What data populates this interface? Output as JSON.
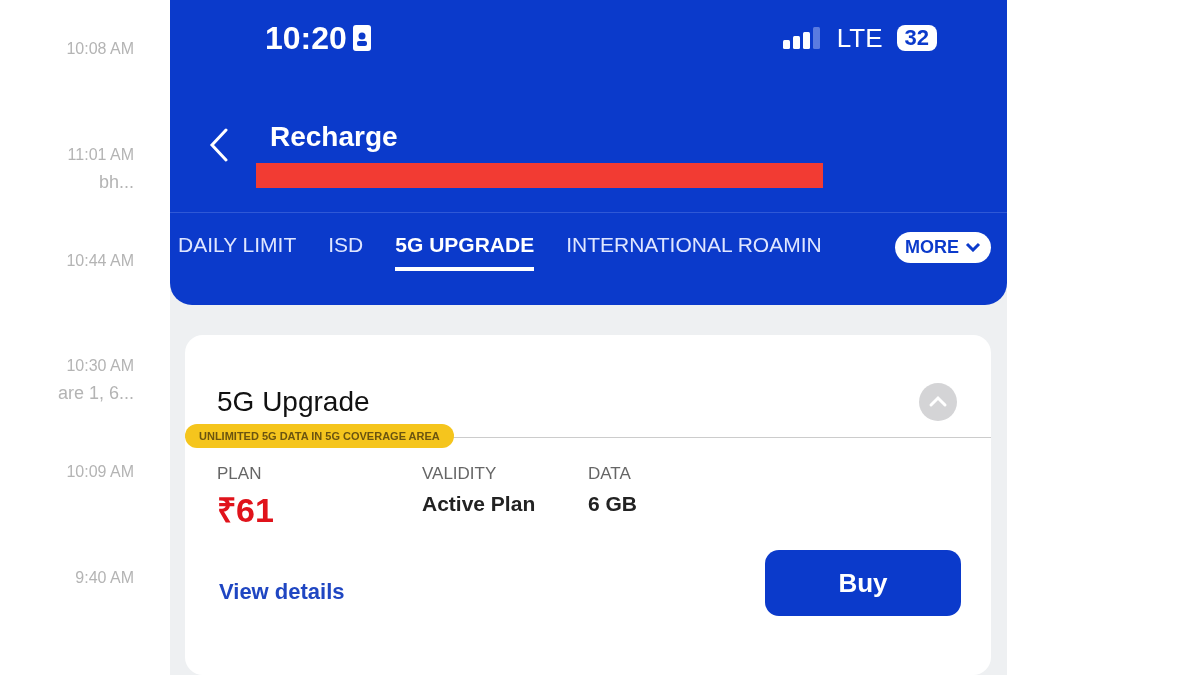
{
  "background_list": [
    {
      "time": "10:08 AM"
    },
    {
      "time": "11:01 AM",
      "snippet": "bh..."
    },
    {
      "time": "10:44 AM"
    },
    {
      "time": "10:30 AM",
      "snippet": "are 1, 6..."
    },
    {
      "time": "10:09 AM"
    },
    {
      "time": "9:40 AM"
    }
  ],
  "status_bar": {
    "time": "10:20",
    "network": "LTE",
    "battery": "32"
  },
  "header": {
    "title": "Recharge"
  },
  "tabs": [
    {
      "label": "DAILY LIMIT",
      "selected": false
    },
    {
      "label": "ISD",
      "selected": false
    },
    {
      "label": "5G UPGRADE",
      "selected": true
    },
    {
      "label": "INTERNATIONAL ROAMIN",
      "selected": false
    }
  ],
  "more_button": {
    "label": "MORE"
  },
  "plan_card": {
    "title": "5G Upgrade",
    "expanded": true,
    "badge": "UNLIMITED 5G DATA IN 5G COVERAGE AREA",
    "fields": [
      {
        "label": "PLAN",
        "value": "₹61",
        "kind": "price"
      },
      {
        "label": "VALIDITY",
        "value": "Active Plan",
        "kind": "text"
      },
      {
        "label": "DATA",
        "value": "6 GB",
        "kind": "text"
      }
    ],
    "link": "View details",
    "button": "Buy"
  }
}
